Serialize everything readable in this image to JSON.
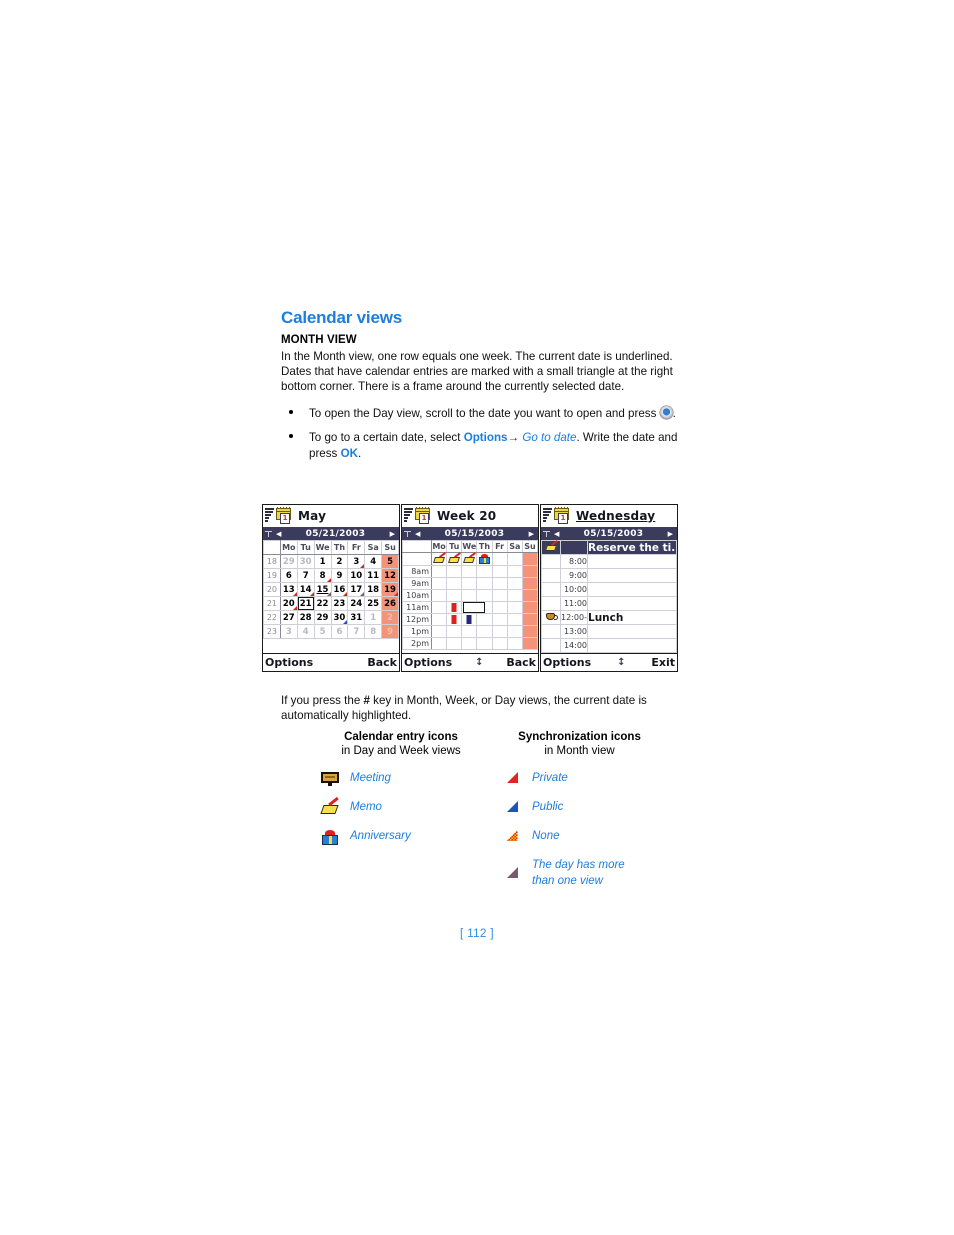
{
  "heading": "Calendar views",
  "subheading": "MONTH VIEW",
  "intro_paragraph": "In the Month view, one row equals one week. The current date is underlined. Dates that have calendar entries are marked with a small triangle at the right bottom corner. There is a frame around the currently selected date.",
  "bullets": [
    {
      "text_before": "To open the Day view, scroll to the date you want to open and press ",
      "text_after": "."
    },
    {
      "text_before": "To go to a certain date, select ",
      "link1": "Options",
      "arrow": "→",
      "link2": "Go to date",
      "text_mid": ". Write the date and press ",
      "link3": "OK",
      "text_after": "."
    }
  ],
  "note": {
    "prefix": "If you press the ",
    "key": "#",
    "suffix": " key in Month, Week, or Day views, the current date is automatically highlighted."
  },
  "screens": {
    "month": {
      "title": "May",
      "date": "05/21/2003",
      "weekday_headers": [
        "Mo",
        "Tu",
        "We",
        "Th",
        "Fr",
        "Sa",
        "Su"
      ],
      "week_numbers": [
        "18",
        "19",
        "20",
        "21",
        "22",
        "23"
      ],
      "rows": [
        [
          {
            "d": "29",
            "other": true
          },
          {
            "d": "30",
            "other": true
          },
          {
            "d": "1"
          },
          {
            "d": "2"
          },
          {
            "d": "3",
            "marker": "red"
          },
          {
            "d": "4"
          },
          {
            "d": "5",
            "sun": true
          }
        ],
        [
          {
            "d": "6"
          },
          {
            "d": "7"
          },
          {
            "d": "8",
            "marker": "red"
          },
          {
            "d": "9"
          },
          {
            "d": "10"
          },
          {
            "d": "11"
          },
          {
            "d": "12",
            "sun": true
          }
        ],
        [
          {
            "d": "13",
            "marker": "red"
          },
          {
            "d": "14",
            "marker": "red"
          },
          {
            "d": "15",
            "marker": "gray",
            "underline": true
          },
          {
            "d": "16",
            "marker": "red"
          },
          {
            "d": "17",
            "marker": "gray"
          },
          {
            "d": "18"
          },
          {
            "d": "19",
            "sun": true,
            "marker": "red"
          }
        ],
        [
          {
            "d": "20",
            "marker": "red"
          },
          {
            "d": "21",
            "selected": true
          },
          {
            "d": "22"
          },
          {
            "d": "23"
          },
          {
            "d": "24"
          },
          {
            "d": "25"
          },
          {
            "d": "26",
            "sun": true
          }
        ],
        [
          {
            "d": "27"
          },
          {
            "d": "28"
          },
          {
            "d": "29"
          },
          {
            "d": "30",
            "marker": "blue"
          },
          {
            "d": "31"
          },
          {
            "d": "1",
            "other": true
          },
          {
            "d": "2",
            "sun": true,
            "other": true
          }
        ],
        [
          {
            "d": "3",
            "other": true
          },
          {
            "d": "4",
            "other": true
          },
          {
            "d": "5",
            "other": true
          },
          {
            "d": "6",
            "other": true
          },
          {
            "d": "7",
            "other": true
          },
          {
            "d": "8",
            "other": true
          },
          {
            "d": "9",
            "sun": true,
            "other": true
          }
        ]
      ],
      "softkey_left": "Options",
      "softkey_right": "Back"
    },
    "week": {
      "title": "Week 20",
      "date": "05/15/2003",
      "weekday_headers": [
        "Mo",
        "Tu",
        "We",
        "Th",
        "Fr",
        "Sa",
        "Su"
      ],
      "hours": [
        "8am",
        "9am",
        "10am",
        "11am",
        "12pm",
        "1pm",
        "2pm"
      ],
      "day_icons": [
        "memo",
        "memo",
        "memo",
        "anniversary",
        "",
        "",
        ""
      ],
      "entries": [
        {
          "hour": "11am",
          "day": "Tu",
          "color": "red"
        },
        {
          "hour": "11am",
          "day": "We",
          "selected": true
        },
        {
          "hour": "12pm",
          "day": "Tu",
          "color": "red"
        },
        {
          "hour": "12pm",
          "day": "We",
          "color": "blue"
        }
      ],
      "softkey_left": "Options",
      "softkey_mid": "↕",
      "softkey_right": "Back"
    },
    "day": {
      "title": "Wednesday",
      "date": "05/15/2003",
      "rows": [
        {
          "icon": "memo",
          "time": "",
          "text": "Reserve the ti..",
          "selected": true
        },
        {
          "icon": "",
          "time": "8:00",
          "text": ""
        },
        {
          "icon": "",
          "time": "9:00",
          "text": ""
        },
        {
          "icon": "",
          "time": "10:00",
          "text": ""
        },
        {
          "icon": "",
          "time": "11:00",
          "text": ""
        },
        {
          "icon": "meeting",
          "time": "12:00-",
          "text": "Lunch"
        },
        {
          "icon": "",
          "time": "13:00",
          "text": ""
        },
        {
          "icon": "",
          "time": "14:00",
          "text": ""
        }
      ],
      "softkey_left": "Options",
      "softkey_mid": "↕",
      "softkey_right": "Exit"
    }
  },
  "legend": {
    "left": {
      "head": "Calendar entry icons",
      "sub": "in Day and Week views",
      "items": [
        {
          "icon": "meeting-icon",
          "label": "Meeting"
        },
        {
          "icon": "memo-icon",
          "label": "Memo"
        },
        {
          "icon": "anniversary-icon",
          "label": "Anniversary"
        }
      ]
    },
    "right": {
      "head": "Synchronization icons",
      "sub": "in Month view",
      "items": [
        {
          "icon": "red-triangle-icon",
          "label": "Private"
        },
        {
          "icon": "blue-triangle-icon",
          "label": "Public"
        },
        {
          "icon": "checkered-triangle-icon",
          "label": "None"
        },
        {
          "icon": "gray-triangle-icon",
          "label": "The day has more\nthan one view"
        }
      ]
    }
  },
  "page_number": "[ 112 ]",
  "colors": {
    "accent_blue": "#1a7fe0",
    "sunday_highlight": "#f5927a",
    "titlebar_navy": "#3b3b5e",
    "marker_red": "#e02020",
    "marker_blue": "#2550c8"
  }
}
